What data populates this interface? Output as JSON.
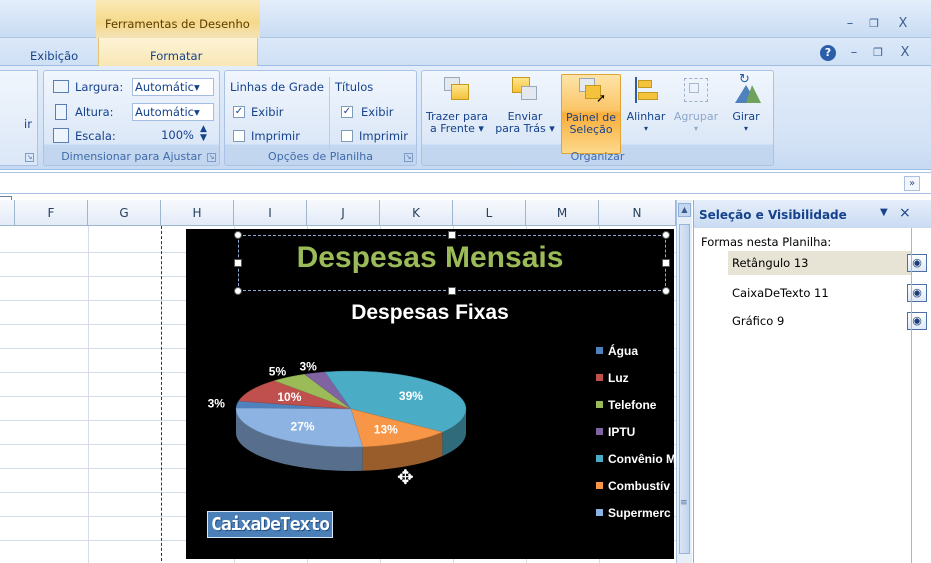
{
  "titlebar": {
    "context_tab_title": "Ferramentas de Desenho",
    "minimize": "–",
    "restore": "❐",
    "close": "X"
  },
  "tabs": {
    "exibicao": "Exibição",
    "formatar": "Formatar"
  },
  "doc_controls": {
    "help": "?",
    "minimize": "–",
    "restore": "❐",
    "close": "X"
  },
  "ribbon": {
    "dimensionar": {
      "label": "Dimensionar para Ajustar",
      "largura_label": "Largura:",
      "largura_value": "Automátic▾",
      "altura_label": "Altura:",
      "altura_value": "Automátic▾",
      "escala_label": "Escala:",
      "escala_value": "100%"
    },
    "opcoes": {
      "label": "Opções de Planilha",
      "linhas_de_grade": "Linhas de Grade",
      "titulos": "Títulos",
      "exibir": "Exibir",
      "imprimir": "Imprimir"
    },
    "organizar": {
      "label": "Organizar",
      "trazer_l1": "Trazer para",
      "trazer_l2": "a Frente ▾",
      "enviar_l1": "Enviar",
      "enviar_l2": "para Trás ▾",
      "painel_l1": "Painel de",
      "painel_l2": "Seleção",
      "alinhar": "Alinhar",
      "agrupar": "Agrupar",
      "girar": "Girar"
    },
    "left_cut_label": "ir"
  },
  "columns": [
    "F",
    "G",
    "H",
    "I",
    "J",
    "K",
    "L",
    "M",
    "N"
  ],
  "chart": {
    "title": "Despesas Mensais",
    "subtitle": "Despesas Fixas",
    "textbox": "CaixaDeTexto"
  },
  "chart_data": {
    "type": "pie",
    "title": "Despesas Fixas",
    "categories": [
      "Água",
      "Luz",
      "Telefone",
      "IPTU",
      "Convênio M",
      "Combustív",
      "Supermerc"
    ],
    "values": [
      3,
      10,
      5,
      3,
      39,
      13,
      27
    ],
    "labels": [
      "3%",
      "10%",
      "5%",
      "3%",
      "39%",
      "13%",
      "27%"
    ],
    "colors": [
      "#4f81bd",
      "#c0504d",
      "#9bbb59",
      "#8064a2",
      "#4bacc6",
      "#f79646",
      "#8db3e2"
    ],
    "legend": "right"
  },
  "pane": {
    "title": "Seleção e Visibilidade",
    "subtitle": "Formas nesta Planilha:",
    "items": [
      "Retângulo 13",
      "CaixaDeTexto 11",
      "Gráfico 9"
    ]
  }
}
